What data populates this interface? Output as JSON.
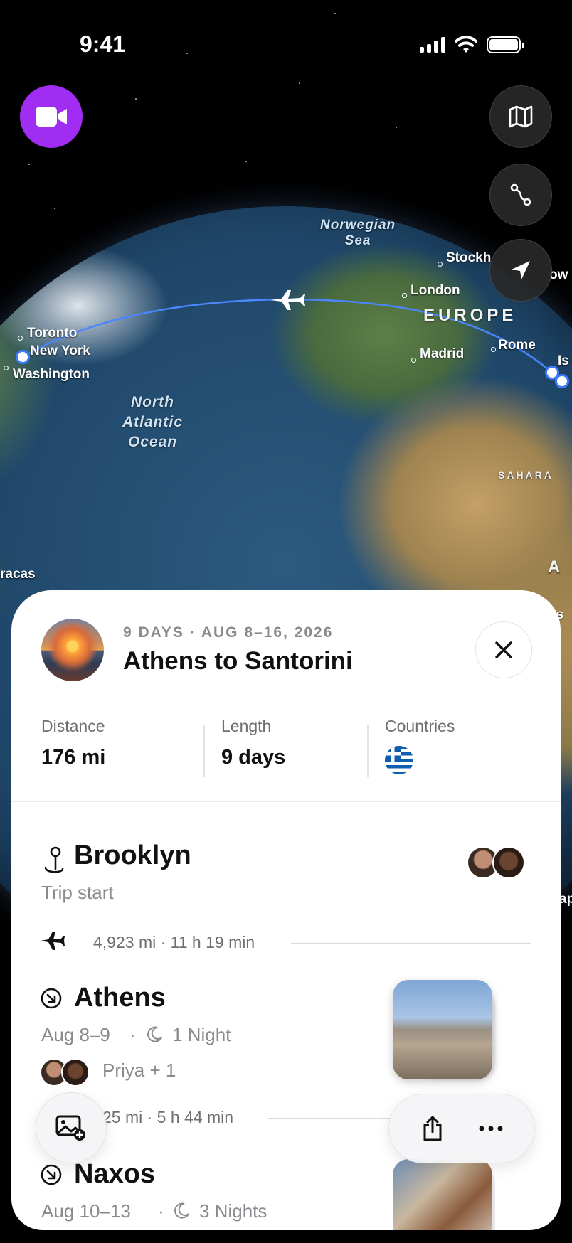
{
  "status_bar": {
    "time": "9:41"
  },
  "map": {
    "labels": {
      "norwegian_sea_1": "Norwegian",
      "norwegian_sea_2": "Sea",
      "stockholm": "Stockh",
      "london": "London",
      "europe": "EUROPE",
      "toronto": "Toronto",
      "new_york": "New York",
      "washington": "Washington",
      "madrid": "Madrid",
      "rome": "Rome",
      "ist": "Is",
      "ocean_1": "North",
      "ocean_2": "Atlantic",
      "ocean_3": "Ocean",
      "sahara": "SAHARA",
      "caracas": "racas",
      "africa": "A",
      "edge_ow": "ow",
      "edge_os": "os",
      "edge_ap": "ap"
    },
    "buttons": [
      "video-record",
      "map-style",
      "route",
      "locate"
    ]
  },
  "trip": {
    "subtitle": "9 DAYS · AUG 8–16, 2026",
    "title": "Athens to Santorini",
    "stats": {
      "distance_label": "Distance",
      "distance_value": "176 mi",
      "length_label": "Length",
      "length_value": "9 days",
      "countries_label": "Countries",
      "country_flag": "greece-flag"
    },
    "stops": [
      {
        "name": "Brooklyn",
        "sub": "Trip start"
      },
      {
        "name": "Athens",
        "dates": "Aug 8–9",
        "nights": "1 Night",
        "people": "Priya + 1"
      },
      {
        "name": "Naxos",
        "dates": "Aug 10–13",
        "nights": "3 Nights"
      }
    ],
    "legs": [
      {
        "text": "4,923 mi · 11 h 19 min"
      },
      {
        "text": "25 mi · 5 h 44 min"
      }
    ]
  },
  "colors": {
    "accent_purple": "#a12cf2",
    "route_blue": "#3a7bff",
    "flag_blue": "#0d5eaf"
  }
}
